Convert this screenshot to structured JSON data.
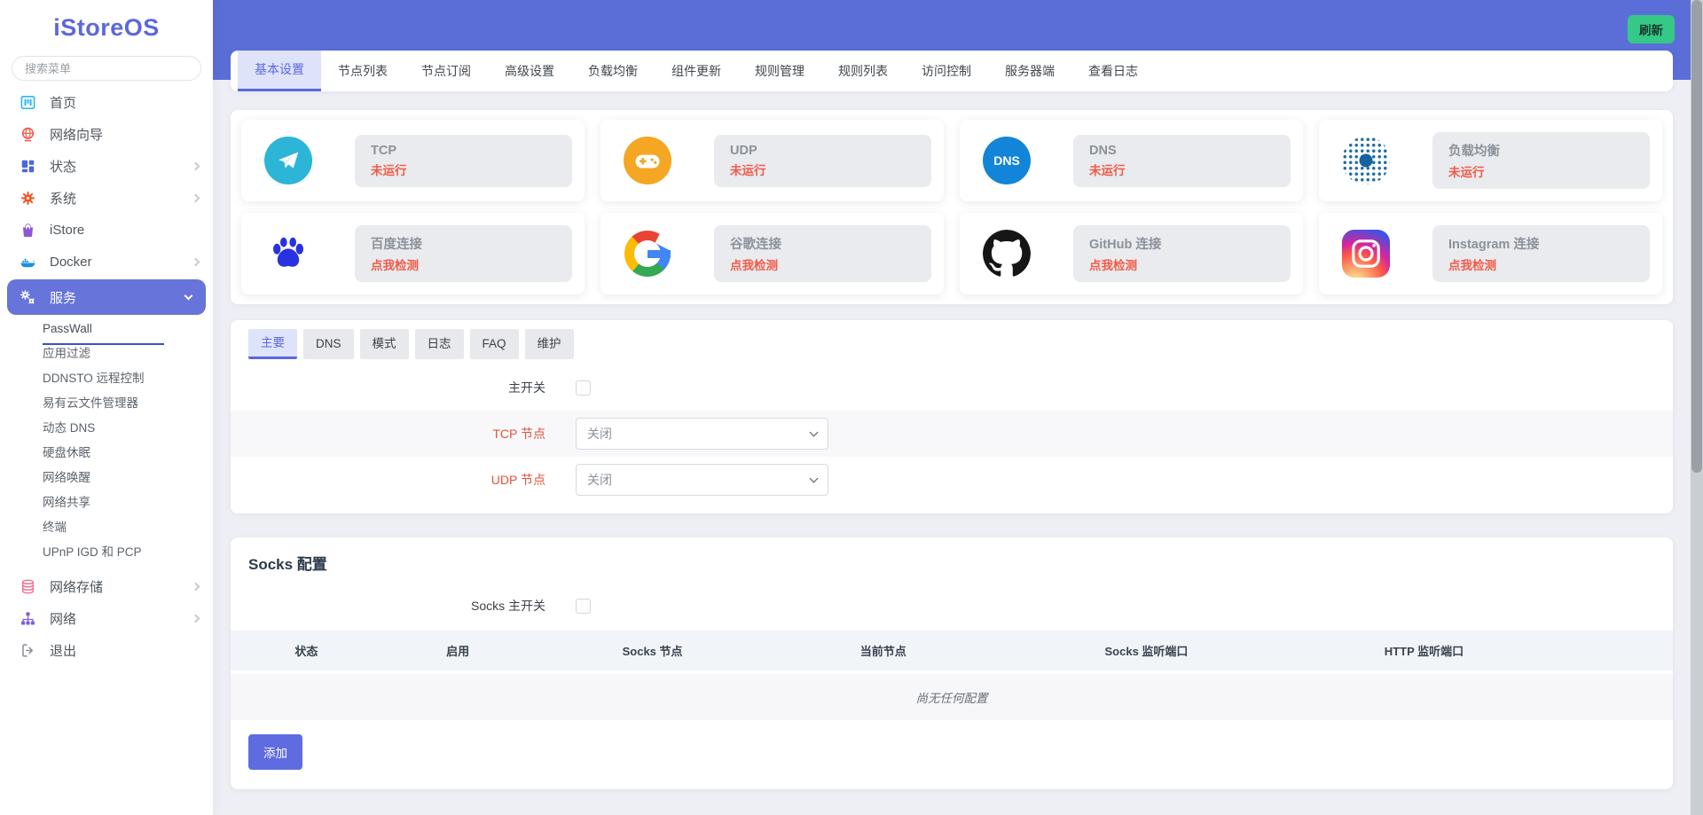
{
  "header": {
    "refresh_label": "刷新"
  },
  "sidebar": {
    "logo": "iStoreOS",
    "search_placeholder": "搜索菜单",
    "items": [
      {
        "label": "首页",
        "icon": "home-icon"
      },
      {
        "label": "网络向导",
        "icon": "globe-icon"
      },
      {
        "label": "状态",
        "icon": "status-squares-icon",
        "chevron": "right"
      },
      {
        "label": "系统",
        "icon": "gear-icon",
        "chevron": "right"
      },
      {
        "label": "iStore",
        "icon": "shopping-bag-icon"
      },
      {
        "label": "Docker",
        "icon": "docker-whale-icon",
        "chevron": "right"
      },
      {
        "label": "服务",
        "icon": "gears-icon",
        "chevron": "down",
        "active": true
      }
    ],
    "submenu": [
      {
        "label": "PassWall",
        "active": true
      },
      {
        "label": "应用过滤"
      },
      {
        "label": "DDNSTO 远程控制"
      },
      {
        "label": "易有云文件管理器"
      },
      {
        "label": "动态 DNS"
      },
      {
        "label": "硬盘休眠"
      },
      {
        "label": "网络唤醒"
      },
      {
        "label": "网络共享"
      },
      {
        "label": "终端"
      },
      {
        "label": "UPnP IGD 和 PCP"
      }
    ],
    "items_bottom": [
      {
        "label": "网络存储",
        "icon": "database-icon",
        "chevron": "right"
      },
      {
        "label": "网络",
        "icon": "sitemap-icon",
        "chevron": "right"
      },
      {
        "label": "退出",
        "icon": "logout-icon"
      }
    ]
  },
  "tabs": [
    {
      "label": "基本设置",
      "active": true
    },
    {
      "label": "节点列表"
    },
    {
      "label": "节点订阅"
    },
    {
      "label": "高级设置"
    },
    {
      "label": "负载均衡"
    },
    {
      "label": "组件更新"
    },
    {
      "label": "规则管理"
    },
    {
      "label": "规则列表"
    },
    {
      "label": "访问控制"
    },
    {
      "label": "服务器端"
    },
    {
      "label": "查看日志"
    }
  ],
  "status_cards": [
    {
      "title": "TCP",
      "status": "未运行",
      "icon": "telegram-icon"
    },
    {
      "title": "UDP",
      "status": "未运行",
      "icon": "gamepad-icon"
    },
    {
      "title": "DNS",
      "status": "未运行",
      "icon": "dns-icon",
      "icon_text": "DNS"
    },
    {
      "title": "负载均衡",
      "status": "未运行",
      "icon": "load-balance-icon"
    },
    {
      "title": "百度连接",
      "status": "点我检测",
      "icon": "baidu-paw-icon"
    },
    {
      "title": "谷歌连接",
      "status": "点我检测",
      "icon": "google-g-icon"
    },
    {
      "title": "GitHub 连接",
      "status": "点我检测",
      "icon": "github-octocat-icon"
    },
    {
      "title": "Instagram 连接",
      "status": "点我检测",
      "icon": "instagram-icon"
    }
  ],
  "form": {
    "subtabs": [
      {
        "label": "主要",
        "active": true
      },
      {
        "label": "DNS"
      },
      {
        "label": "模式"
      },
      {
        "label": "日志"
      },
      {
        "label": "FAQ"
      },
      {
        "label": "维护"
      }
    ],
    "rows": [
      {
        "label": "主开关",
        "control": "checkbox",
        "checked": false
      },
      {
        "label": "TCP 节点",
        "control": "select",
        "value": "关闭"
      },
      {
        "label": "UDP 节点",
        "control": "select",
        "value": "关闭"
      }
    ]
  },
  "socks": {
    "title": "Socks 配置",
    "switch_label": "Socks 主开关",
    "switch_checked": false,
    "table_headers": [
      "状态",
      "启用",
      "Socks 节点",
      "当前节点",
      "Socks 监听端口",
      "HTTP 监听端口"
    ],
    "empty_text": "尚无任何配置",
    "add_label": "添加"
  },
  "colors": {
    "accent_indigo": "#5b6ed8",
    "active_menu": "#6774da",
    "refresh_green": "#35c886",
    "status_red": "#f25b49",
    "label_red": "#e8503c",
    "tab_active_bg": "#dfe3f9"
  }
}
